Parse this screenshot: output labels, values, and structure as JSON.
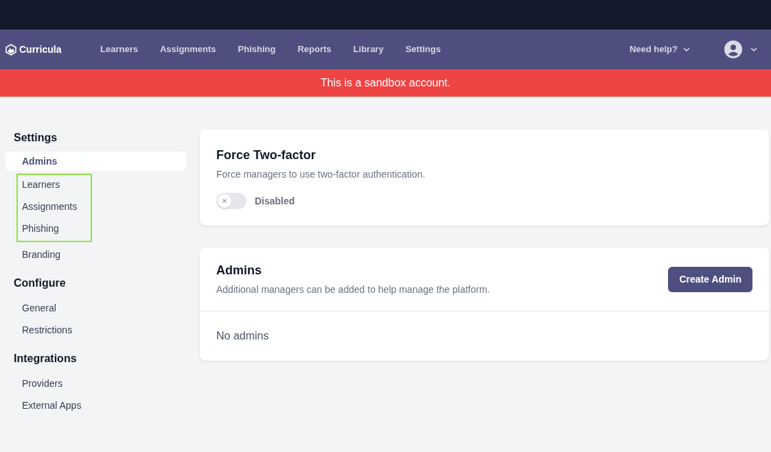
{
  "brand": {
    "name": "Curricula"
  },
  "nav": {
    "links": [
      {
        "label": "Learners"
      },
      {
        "label": "Assignments"
      },
      {
        "label": "Phishing"
      },
      {
        "label": "Reports"
      },
      {
        "label": "Library"
      },
      {
        "label": "Settings"
      }
    ],
    "help": "Need help?"
  },
  "banner": "This is a sandbox account.",
  "sidebar": {
    "sections": [
      {
        "heading": "Settings",
        "items": [
          {
            "label": "Admins",
            "selected": true,
            "highlighted": false
          },
          {
            "label": "Learners",
            "selected": false,
            "highlighted": true
          },
          {
            "label": "Assignments",
            "selected": false,
            "highlighted": true
          },
          {
            "label": "Phishing",
            "selected": false,
            "highlighted": true
          },
          {
            "label": "Branding",
            "selected": false,
            "highlighted": false
          }
        ]
      },
      {
        "heading": "Configure",
        "items": [
          {
            "label": "General",
            "selected": false,
            "highlighted": false
          },
          {
            "label": "Restrictions",
            "selected": false,
            "highlighted": false
          }
        ]
      },
      {
        "heading": "Integrations",
        "items": [
          {
            "label": "Providers",
            "selected": false,
            "highlighted": false
          },
          {
            "label": "External Apps",
            "selected": false,
            "highlighted": false
          }
        ]
      }
    ]
  },
  "two_factor": {
    "title": "Force Two-factor",
    "description": "Force managers to use two-factor authentication.",
    "toggle": {
      "on": false,
      "label": "Disabled"
    }
  },
  "admins": {
    "title": "Admins",
    "description": "Additional managers can be added to help manage the platform.",
    "button": "Create Admin",
    "empty": "No admins"
  }
}
